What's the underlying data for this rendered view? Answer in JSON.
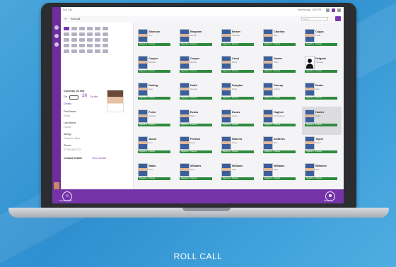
{
  "app": {
    "title": "Roll Call",
    "header_info": "Wednesday, 3:52 PM",
    "back_label": "Roll call",
    "search_placeholder": "Search"
  },
  "left_panel": {
    "calendar": {
      "rows": 5,
      "cols": 6,
      "active_index": 0
    },
    "current_label": "Currently On Site",
    "toggle_label": "On",
    "count": "30",
    "count_suffix": "On site",
    "details_link": "Details",
    "fields": [
      {
        "label": "First Name",
        "value": "Emily"
      },
      {
        "label": "Last Name",
        "value": "Hunter"
      },
      {
        "label": "Allergy",
        "value": "Peanuts, dairy"
      },
      {
        "label": "Phone",
        "value": "07700 900 123"
      }
    ],
    "contact_label": "Contact Details",
    "contact_link": "View contact"
  },
  "students": [
    {
      "last": "Atkinson",
      "first": "Jon",
      "status": "Signed in - Present"
    },
    {
      "last": "Bingham",
      "first": "Harriet",
      "status": "Signed in - Present"
    },
    {
      "last": "Brown",
      "first": "Thomas",
      "status": "Signed in - Present"
    },
    {
      "last": "Charlton",
      "first": "Ben",
      "status": "Signed in - Present"
    },
    {
      "last": "Copps",
      "first": "Philip",
      "status": "Signed in - Present"
    },
    {
      "last": "Cooper",
      "first": "Michael",
      "status": "Signed in - Present"
    },
    {
      "last": "Cooper",
      "first": "Rachel",
      "status": "Signed in - Present"
    },
    {
      "last": "Crust",
      "first": "Ricky",
      "status": "Signed in - Present"
    },
    {
      "last": "Davies",
      "first": "Rhys",
      "status": "Signed in - Present"
    },
    {
      "last": "Delgado",
      "first": "Thomas",
      "status": "Signed in - Present",
      "silhouette": true
    },
    {
      "last": "Darling",
      "first": "Sam",
      "status": "Signed in - Present"
    },
    {
      "last": "Dodd",
      "first": "George",
      "status": "Signed in - Present"
    },
    {
      "last": "Douglas",
      "first": "Peter",
      "status": "Signed in - Present"
    },
    {
      "last": "Dunray",
      "first": "Callum",
      "status": "Signed in - Present"
    },
    {
      "last": "Easter",
      "first": "Alex",
      "status": "Signed in - Present"
    },
    {
      "last": "Forbe",
      "first": "Jackson",
      "status": "Signed in - Present"
    },
    {
      "last": "Evans",
      "first": "Mark",
      "status": "Signed in - Present"
    },
    {
      "last": "Evans",
      "first": "Owen",
      "status": "Signed in - Present"
    },
    {
      "last": "Hughes",
      "first": "Christopher",
      "status": "Signed in - Present"
    },
    {
      "last": "Hunter",
      "first": "Emily",
      "status": "Signed in - Present",
      "selected": true
    },
    {
      "last": "Jacob",
      "first": "Tom",
      "status": "Signed in - Present"
    },
    {
      "last": "Preston",
      "first": "Chris",
      "status": "Signed in - Present"
    },
    {
      "last": "Roberts",
      "first": "Steve",
      "status": "Signed in - Present"
    },
    {
      "last": "Smithies",
      "first": "Ben",
      "status": "Signed in - Present"
    },
    {
      "last": "Taylor",
      "first": "Oliver",
      "status": "Signed in - Present"
    },
    {
      "last": "Watts",
      "first": "Peter",
      "status": "Signed in - Present"
    },
    {
      "last": "Williams",
      "first": "Dave",
      "status": "Signed in - Present"
    },
    {
      "last": "Williams",
      "first": "Kate",
      "status": "Signed in - Present"
    },
    {
      "last": "Williams",
      "first": "Mike",
      "status": "Signed in - Present"
    },
    {
      "last": "Wiltshire",
      "first": "Rob",
      "status": "Signed in - Present"
    }
  ],
  "bottom": {
    "left_label": "Select All / None",
    "right_label": "Add Visitor"
  },
  "caption": "ROLL CALL",
  "colors": {
    "accent_purple": "#7434a8",
    "status_green": "#2e8b3e",
    "background_blue": "#3a9ad6"
  }
}
